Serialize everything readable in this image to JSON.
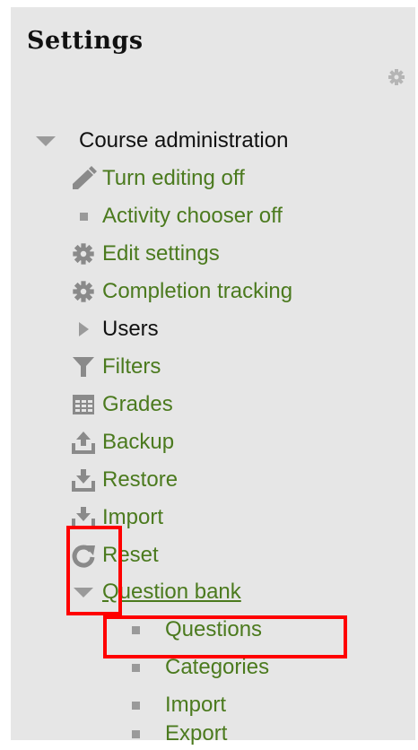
{
  "block": {
    "title": "Settings",
    "course_admin": {
      "label": "Course administration",
      "items": [
        {
          "label": "Turn editing off",
          "icon": "pencil-icon"
        },
        {
          "label": "Activity chooser off",
          "icon": "bullet-icon"
        },
        {
          "label": "Edit settings",
          "icon": "gear-icon"
        },
        {
          "label": "Completion tracking",
          "icon": "gear-icon"
        },
        {
          "label": "Users",
          "icon": "triangle-right-icon"
        },
        {
          "label": "Filters",
          "icon": "filter-icon"
        },
        {
          "label": "Grades",
          "icon": "grades-table-icon"
        },
        {
          "label": "Backup",
          "icon": "upload-icon"
        },
        {
          "label": "Restore",
          "icon": "download-icon"
        },
        {
          "label": "Import",
          "icon": "download-icon"
        },
        {
          "label": "Reset",
          "icon": "reset-icon"
        }
      ],
      "question_bank": {
        "label": "Question bank",
        "items": [
          {
            "label": "Questions"
          },
          {
            "label": "Categories"
          },
          {
            "label": "Import"
          },
          {
            "label": "Export"
          }
        ]
      }
    }
  },
  "colors": {
    "link": "#4b7a1e",
    "panel_bg": "#e6e6e6",
    "icon": "#8a8a8a",
    "highlight": "#ff0000"
  }
}
